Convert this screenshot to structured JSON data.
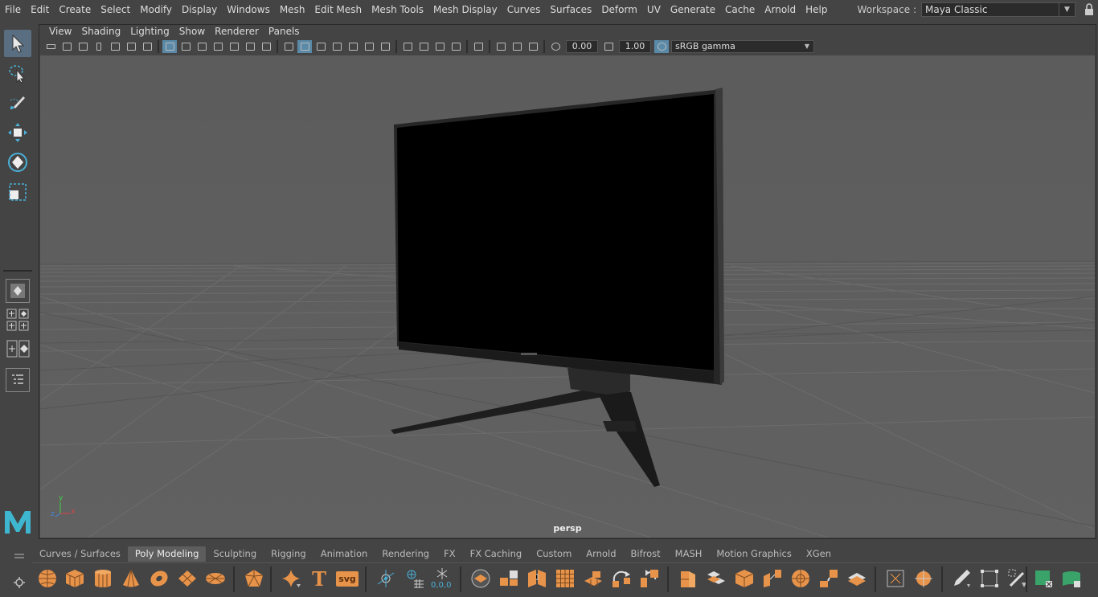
{
  "menubar": {
    "items": [
      "File",
      "Edit",
      "Create",
      "Select",
      "Modify",
      "Display",
      "Windows",
      "Mesh",
      "Edit Mesh",
      "Mesh Tools",
      "Mesh Display",
      "Curves",
      "Surfaces",
      "Deform",
      "UV",
      "Generate",
      "Cache",
      "Arnold",
      "Help"
    ]
  },
  "workspace": {
    "label": "Workspace :",
    "value": "Maya Classic"
  },
  "toolbox": {
    "tools": [
      {
        "name": "select-tool",
        "icon": "arrow-cursor-icon",
        "active": true
      },
      {
        "name": "lasso-select-tool",
        "icon": "lasso-icon",
        "active": false
      },
      {
        "name": "paint-select-tool",
        "icon": "brush-icon",
        "active": false
      },
      {
        "name": "move-tool",
        "icon": "move-icon",
        "active": false
      },
      {
        "name": "rotate-tool",
        "icon": "rotate-icon",
        "active": false
      },
      {
        "name": "scale-tool",
        "icon": "scale-icon",
        "active": false
      }
    ]
  },
  "panel": {
    "menu": [
      "View",
      "Shading",
      "Lighting",
      "Show",
      "Renderer",
      "Panels"
    ],
    "exposure": "0.00",
    "gamma": "1.00",
    "color_management": "sRGB gamma",
    "camera_label": "persp",
    "axis": {
      "x": "x",
      "y": "y",
      "z": "z"
    }
  },
  "shelf": {
    "tabs": [
      {
        "label": "Curves / Surfaces",
        "active": false
      },
      {
        "label": "Poly Modeling",
        "active": true
      },
      {
        "label": "Sculpting",
        "active": false
      },
      {
        "label": "Rigging",
        "active": false
      },
      {
        "label": "Animation",
        "active": false
      },
      {
        "label": "Rendering",
        "active": false
      },
      {
        "label": "FX",
        "active": false
      },
      {
        "label": "FX Caching",
        "active": false
      },
      {
        "label": "Custom",
        "active": false
      },
      {
        "label": "Arnold",
        "active": false
      },
      {
        "label": "Bifrost",
        "active": false
      },
      {
        "label": "MASH",
        "active": false
      },
      {
        "label": "Motion Graphics",
        "active": false
      },
      {
        "label": "XGen",
        "active": false
      }
    ],
    "icons": [
      "poly-sphere-icon",
      "poly-cube-icon",
      "poly-cylinder-icon",
      "poly-cone-icon",
      "poly-torus-icon",
      "poly-plane-icon",
      "poly-disc-icon",
      "platonic-solid-icon",
      "super-shape-icon",
      "type-text-icon",
      "svg-icon",
      "combine-icon",
      "separate-icon",
      "merge-icon",
      "smooth-icon",
      "extrude-icon",
      "bridge-icon",
      "bevel-icon",
      "fill-hole-icon",
      "boolean-icon",
      "mirror-icon",
      "multi-cut-icon",
      "target-weld-icon",
      "connect-icon",
      "quad-draw-icon",
      "insert-edge-loop-icon",
      "offset-edge-loop-icon",
      "slide-edge-icon",
      "add-divisions-icon",
      "uv-editor-icon",
      "planar-map-icon",
      "pencil-icon",
      "lattice-icon",
      "soft-mod-icon",
      "uv-layout-icon",
      "uv-unfold-icon"
    ],
    "svg_label": "svg",
    "coord_label": "0,0,0",
    "type_label": "T"
  },
  "colors": {
    "active_tool": "#5a6e82",
    "shelf_accent": "#e8934a",
    "viewport_bg": "#5e5e5e"
  }
}
